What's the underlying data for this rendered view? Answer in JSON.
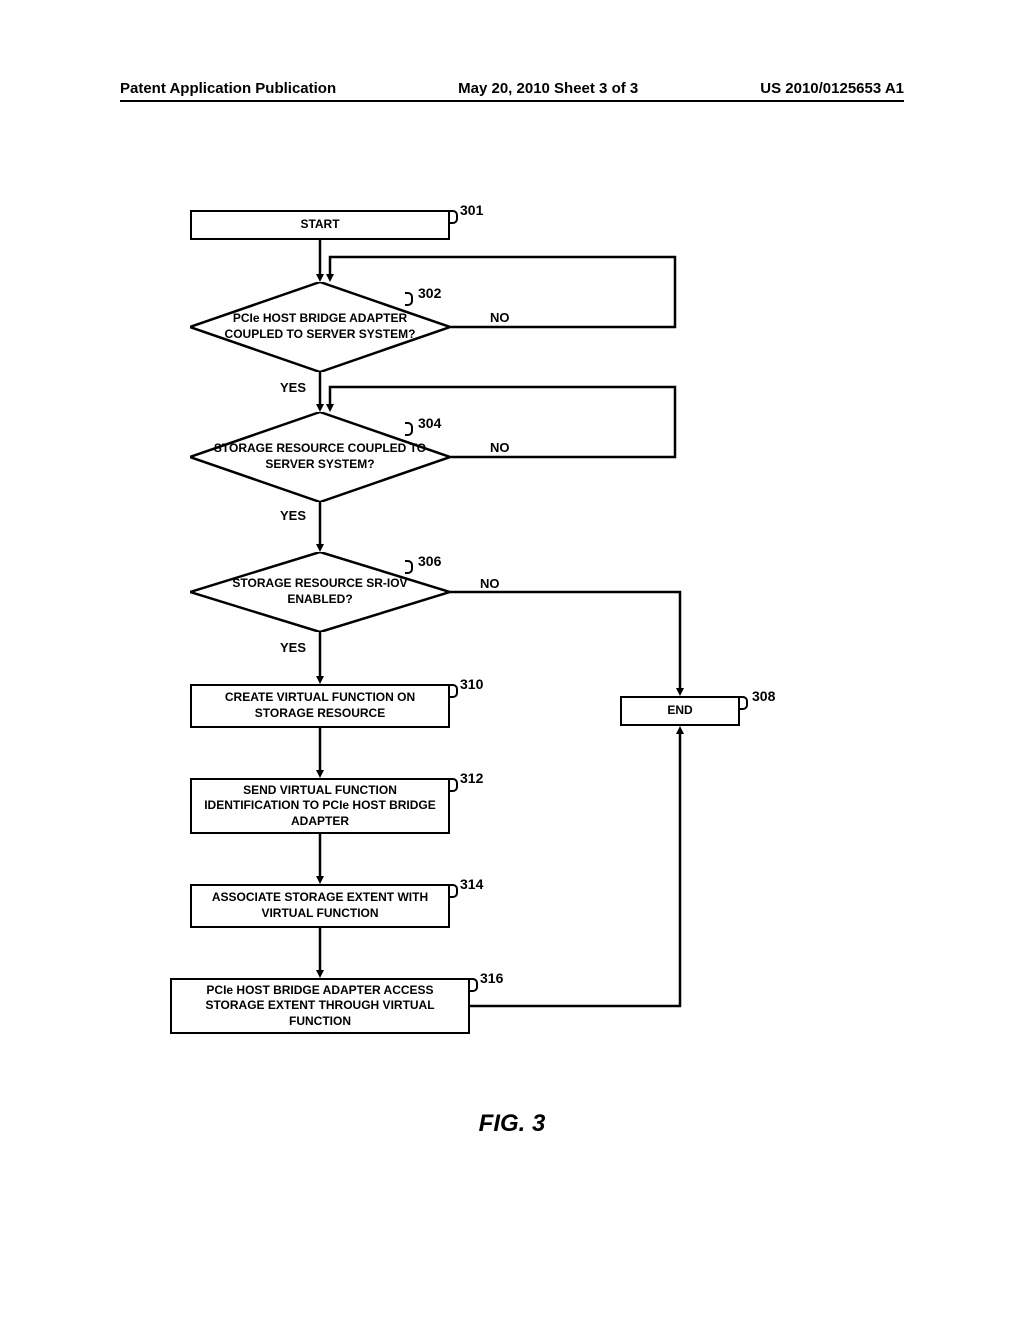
{
  "header": {
    "left": "Patent Application Publication",
    "center": "May 20, 2010  Sheet 3 of 3",
    "right": "US 2010/0125653 A1"
  },
  "figure": "FIG. 3",
  "chart_data": {
    "type": "flowchart",
    "nodes": [
      {
        "id": "301",
        "shape": "rect",
        "label": "START"
      },
      {
        "id": "302",
        "shape": "diamond",
        "label": "PCIe HOST BRIDGE ADAPTER COUPLED TO SERVER SYSTEM?"
      },
      {
        "id": "304",
        "shape": "diamond",
        "label": "STORAGE RESOURCE COUPLED TO SERVER SYSTEM?"
      },
      {
        "id": "306",
        "shape": "diamond",
        "label": "STORAGE RESOURCE SR-IOV ENABLED?"
      },
      {
        "id": "310",
        "shape": "rect",
        "label": "CREATE VIRTUAL FUNCTION ON STORAGE RESOURCE"
      },
      {
        "id": "308",
        "shape": "rect",
        "label": "END"
      },
      {
        "id": "312",
        "shape": "rect",
        "label": "SEND VIRTUAL FUNCTION IDENTIFICATION TO PCIe HOST BRIDGE ADAPTER"
      },
      {
        "id": "314",
        "shape": "rect",
        "label": "ASSOCIATE STORAGE EXTENT WITH VIRTUAL FUNCTION"
      },
      {
        "id": "316",
        "shape": "rect",
        "label": "PCIe HOST BRIDGE ADAPTER ACCESS STORAGE EXTENT THROUGH VIRTUAL FUNCTION"
      }
    ],
    "edges": [
      {
        "from": "301",
        "to": "302",
        "label": ""
      },
      {
        "from": "302",
        "to": "304",
        "label": "YES"
      },
      {
        "from": "302",
        "to": "302",
        "label": "NO",
        "loop": true
      },
      {
        "from": "304",
        "to": "306",
        "label": "YES"
      },
      {
        "from": "304",
        "to": "304",
        "label": "NO",
        "loop": true
      },
      {
        "from": "306",
        "to": "310",
        "label": "YES"
      },
      {
        "from": "306",
        "to": "308",
        "label": "NO"
      },
      {
        "from": "310",
        "to": "312",
        "label": ""
      },
      {
        "from": "312",
        "to": "314",
        "label": ""
      },
      {
        "from": "314",
        "to": "316",
        "label": ""
      },
      {
        "from": "316",
        "to": "308",
        "label": ""
      }
    ]
  },
  "labels": {
    "yes": "YES",
    "no": "NO"
  }
}
